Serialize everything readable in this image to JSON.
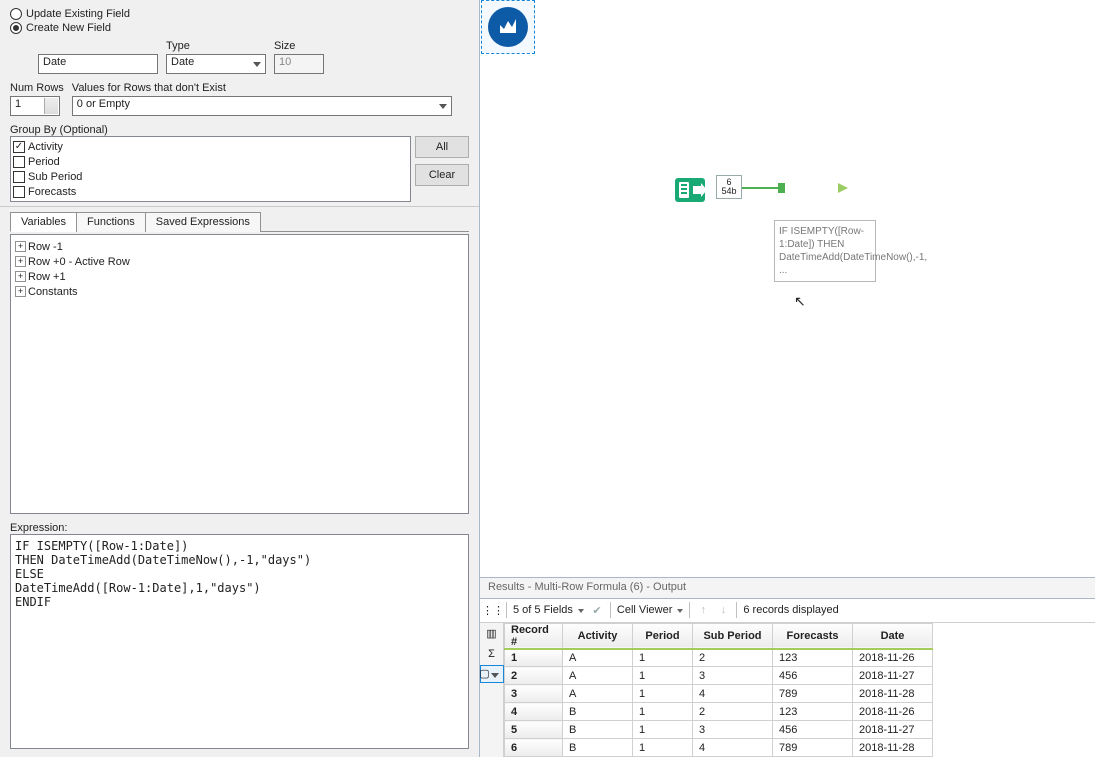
{
  "config": {
    "update_existing_label": "Update Existing Field",
    "create_new_label": "Create New  Field",
    "field_name": "Date",
    "type_label": "Type",
    "type_value": "Date",
    "size_label": "Size",
    "size_value": "10",
    "num_rows_label": "Num Rows",
    "num_rows_value": "1",
    "missing_label": "Values for Rows that don't Exist",
    "missing_value": "0 or Empty",
    "group_by_label": "Group By (Optional)",
    "group_items": [
      {
        "label": "Activity",
        "checked": true
      },
      {
        "label": "Period",
        "checked": false
      },
      {
        "label": "Sub Period",
        "checked": false
      },
      {
        "label": "Forecasts",
        "checked": false
      }
    ],
    "btn_all": "All",
    "btn_clear": "Clear"
  },
  "tabs": {
    "variables": "Variables",
    "functions": "Functions",
    "saved": "Saved Expressions"
  },
  "tree": [
    "Row -1",
    "Row +0 - Active Row",
    "Row +1",
    "Constants"
  ],
  "expression_label": "Expression:",
  "expression": "IF ISEMPTY([Row-1:Date])\nTHEN DateTimeAdd(DateTimeNow(),-1,\"days\")\nELSE\nDateTimeAdd([Row-1:Date],1,\"days\")\nENDIF",
  "canvas": {
    "badge_top": "6",
    "badge_bottom": "54b",
    "tool_caption": "IF ISEMPTY([Row-1:Date]) THEN DateTimeAdd(DateTimeNow(),-1, ..."
  },
  "results": {
    "title": "Results - Multi-Row Formula (6) - Output",
    "fields_summary": "5 of 5 Fields",
    "cell_viewer": "Cell Viewer",
    "records": "6 records displayed",
    "headers": [
      "Record #",
      "Activity",
      "Period",
      "Sub Period",
      "Forecasts",
      "Date"
    ],
    "rows": [
      [
        "1",
        "A",
        "1",
        "2",
        "123",
        "2018-11-26"
      ],
      [
        "2",
        "A",
        "1",
        "3",
        "456",
        "2018-11-27"
      ],
      [
        "3",
        "A",
        "1",
        "4",
        "789",
        "2018-11-28"
      ],
      [
        "4",
        "B",
        "1",
        "2",
        "123",
        "2018-11-26"
      ],
      [
        "5",
        "B",
        "1",
        "3",
        "456",
        "2018-11-27"
      ],
      [
        "6",
        "B",
        "1",
        "4",
        "789",
        "2018-11-28"
      ]
    ]
  }
}
